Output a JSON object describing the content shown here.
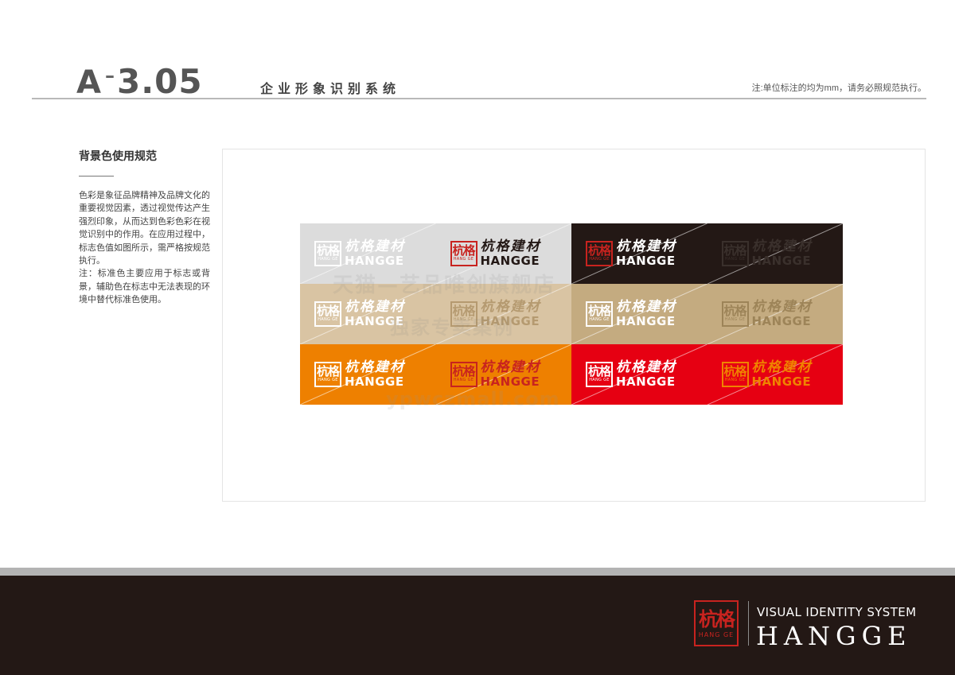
{
  "header": {
    "code_prefix": "A",
    "code_dash": "–",
    "code_number": "3.05",
    "system_title": "企业形象识别系统",
    "note": "注:单位标注的均为mm，请务必照规范执行。"
  },
  "section": {
    "title": "背景色使用规范",
    "paragraph_1": "色彩是象征品牌精神及品牌文化的重要视觉因素，透过视觉传达产生强烈印象，从而达到色彩色彩在视觉识别中的作用。在应用过程中，标志色值如图所示，需严格按规范执行。",
    "paragraph_2": "注：标准色主要应用于标志或背景，辅助色在标志中无法表现的环境中替代标准色使用。"
  },
  "logo": {
    "seal_glyph": "杭格",
    "seal_sub": "HANG GE",
    "chinese": "杭格建材",
    "english": "HANGGE"
  },
  "swatches": [
    {
      "background": "#dcdcdc",
      "logo_color": "#ffffff",
      "seal_color": "#ffffff"
    },
    {
      "background": "#dcdcdc",
      "logo_color": "#231815",
      "seal_color": "#c8231f"
    },
    {
      "background": "#231815",
      "logo_color": "#ffffff",
      "seal_color": "#c8231f"
    },
    {
      "background": "#231815",
      "logo_color": "#3a302c",
      "seal_color": "#3a302c"
    },
    {
      "background": "#d9c4a3",
      "logo_color": "#ffffff",
      "seal_color": "#ffffff"
    },
    {
      "background": "#d9c4a3",
      "logo_color": "#b59a70",
      "seal_color": "#b59a70"
    },
    {
      "background": "#c4ab80",
      "logo_color": "#ffffff",
      "seal_color": "#ffffff"
    },
    {
      "background": "#c4ab80",
      "logo_color": "#9d8458",
      "seal_color": "#9d8458"
    },
    {
      "background": "#ee8000",
      "logo_color": "#ffffff",
      "seal_color": "#ffffff"
    },
    {
      "background": "#ee8000",
      "logo_color": "#c8231f",
      "seal_color": "#c8231f"
    },
    {
      "background": "#e60012",
      "logo_color": "#ffffff",
      "seal_color": "#ffffff"
    },
    {
      "background": "#e60012",
      "logo_color": "#f08300",
      "seal_color": "#f08300"
    }
  ],
  "watermark": {
    "line_1": "天猫—艺品唯创旗舰店",
    "line_2": "独家专卖案例",
    "line_3": "ypwczmall.com"
  },
  "footer": {
    "seal_glyph": "杭格",
    "seal_sub": "HANG GE",
    "subtitle": "VISUAL IDENTITY SYSTEM",
    "brand": "HANGGE",
    "background": "#231815",
    "accent": "#c8231f"
  }
}
